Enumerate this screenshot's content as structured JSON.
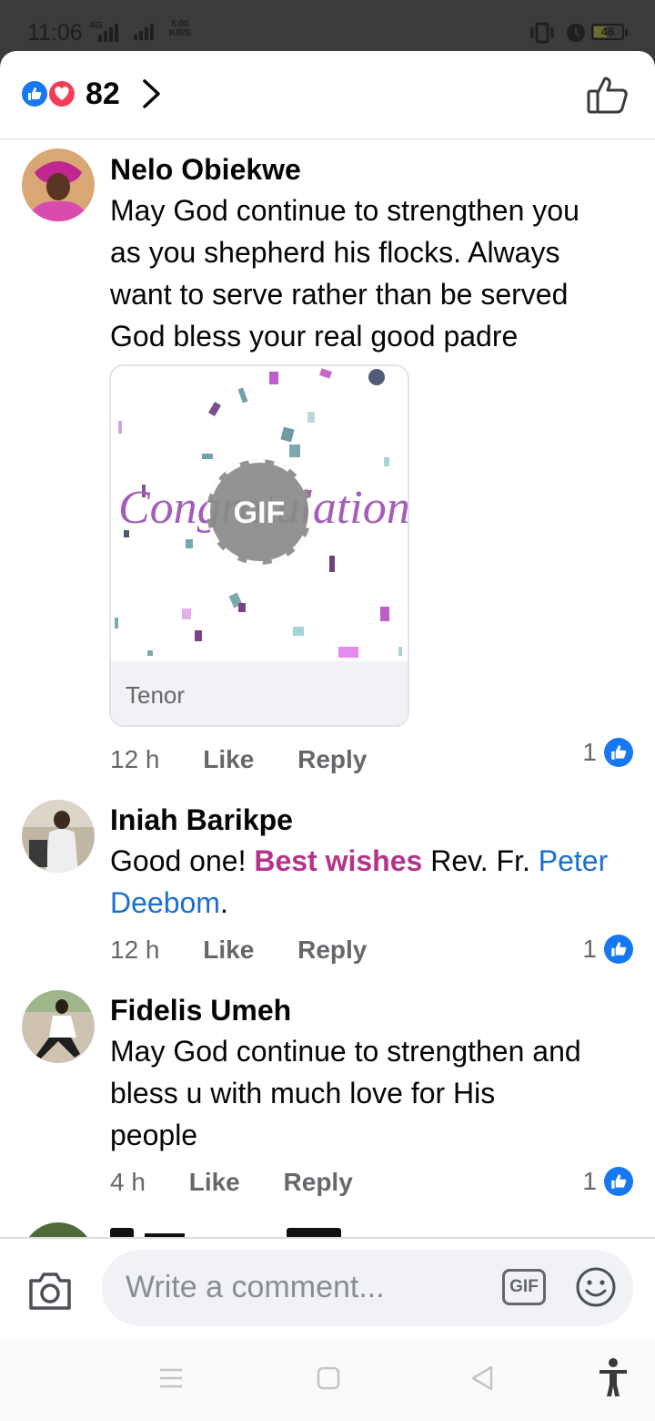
{
  "status_bar": {
    "time": "11:06",
    "network": "4G",
    "speed_value": "5.00",
    "speed_unit": "KB/S",
    "battery": "46"
  },
  "header": {
    "reaction_count": "82",
    "icons": [
      "like-reaction-icon",
      "love-reaction-icon",
      "chevron-right-icon",
      "thumbs-up-outline-icon"
    ]
  },
  "comments": [
    {
      "author": "Nelo Obiekwe",
      "lines": [
        "May God continue to strengthen you",
        "as you shepherd his flocks.  Always",
        "want to serve rather than be served",
        "God bless your real good  padre"
      ],
      "gif": {
        "overlay_label": "GIF",
        "art_text": "Congratulations!",
        "source": "Tenor"
      },
      "time": "12 h",
      "like_label": "Like",
      "reply_label": "Reply",
      "reaction_count": "1"
    },
    {
      "author": "Iniah Barikpe",
      "text_part1": "Good one! ",
      "highlight": "Best wishes",
      "text_part2": " Rev. Fr. ",
      "mention_part1": "Peter",
      "mention_part2": "Deebom",
      "text_part3": ".",
      "time": "12 h",
      "like_label": "Like",
      "reply_label": "Reply",
      "reaction_count": "1"
    },
    {
      "author": "Fidelis Umeh",
      "lines": [
        "May God continue to strengthen and",
        "bless u with much love for His",
        "people"
      ],
      "time": "4 h",
      "like_label": "Like",
      "reply_label": "Reply",
      "reaction_count": "1"
    }
  ],
  "composer": {
    "placeholder": "Write a comment...",
    "gif_label": "GIF"
  },
  "colors": {
    "facebook_blue": "#1877f2",
    "love_red": "#f33e58",
    "highlight_magenta": "#b5338a",
    "mention_blue": "#1a6fd1"
  }
}
